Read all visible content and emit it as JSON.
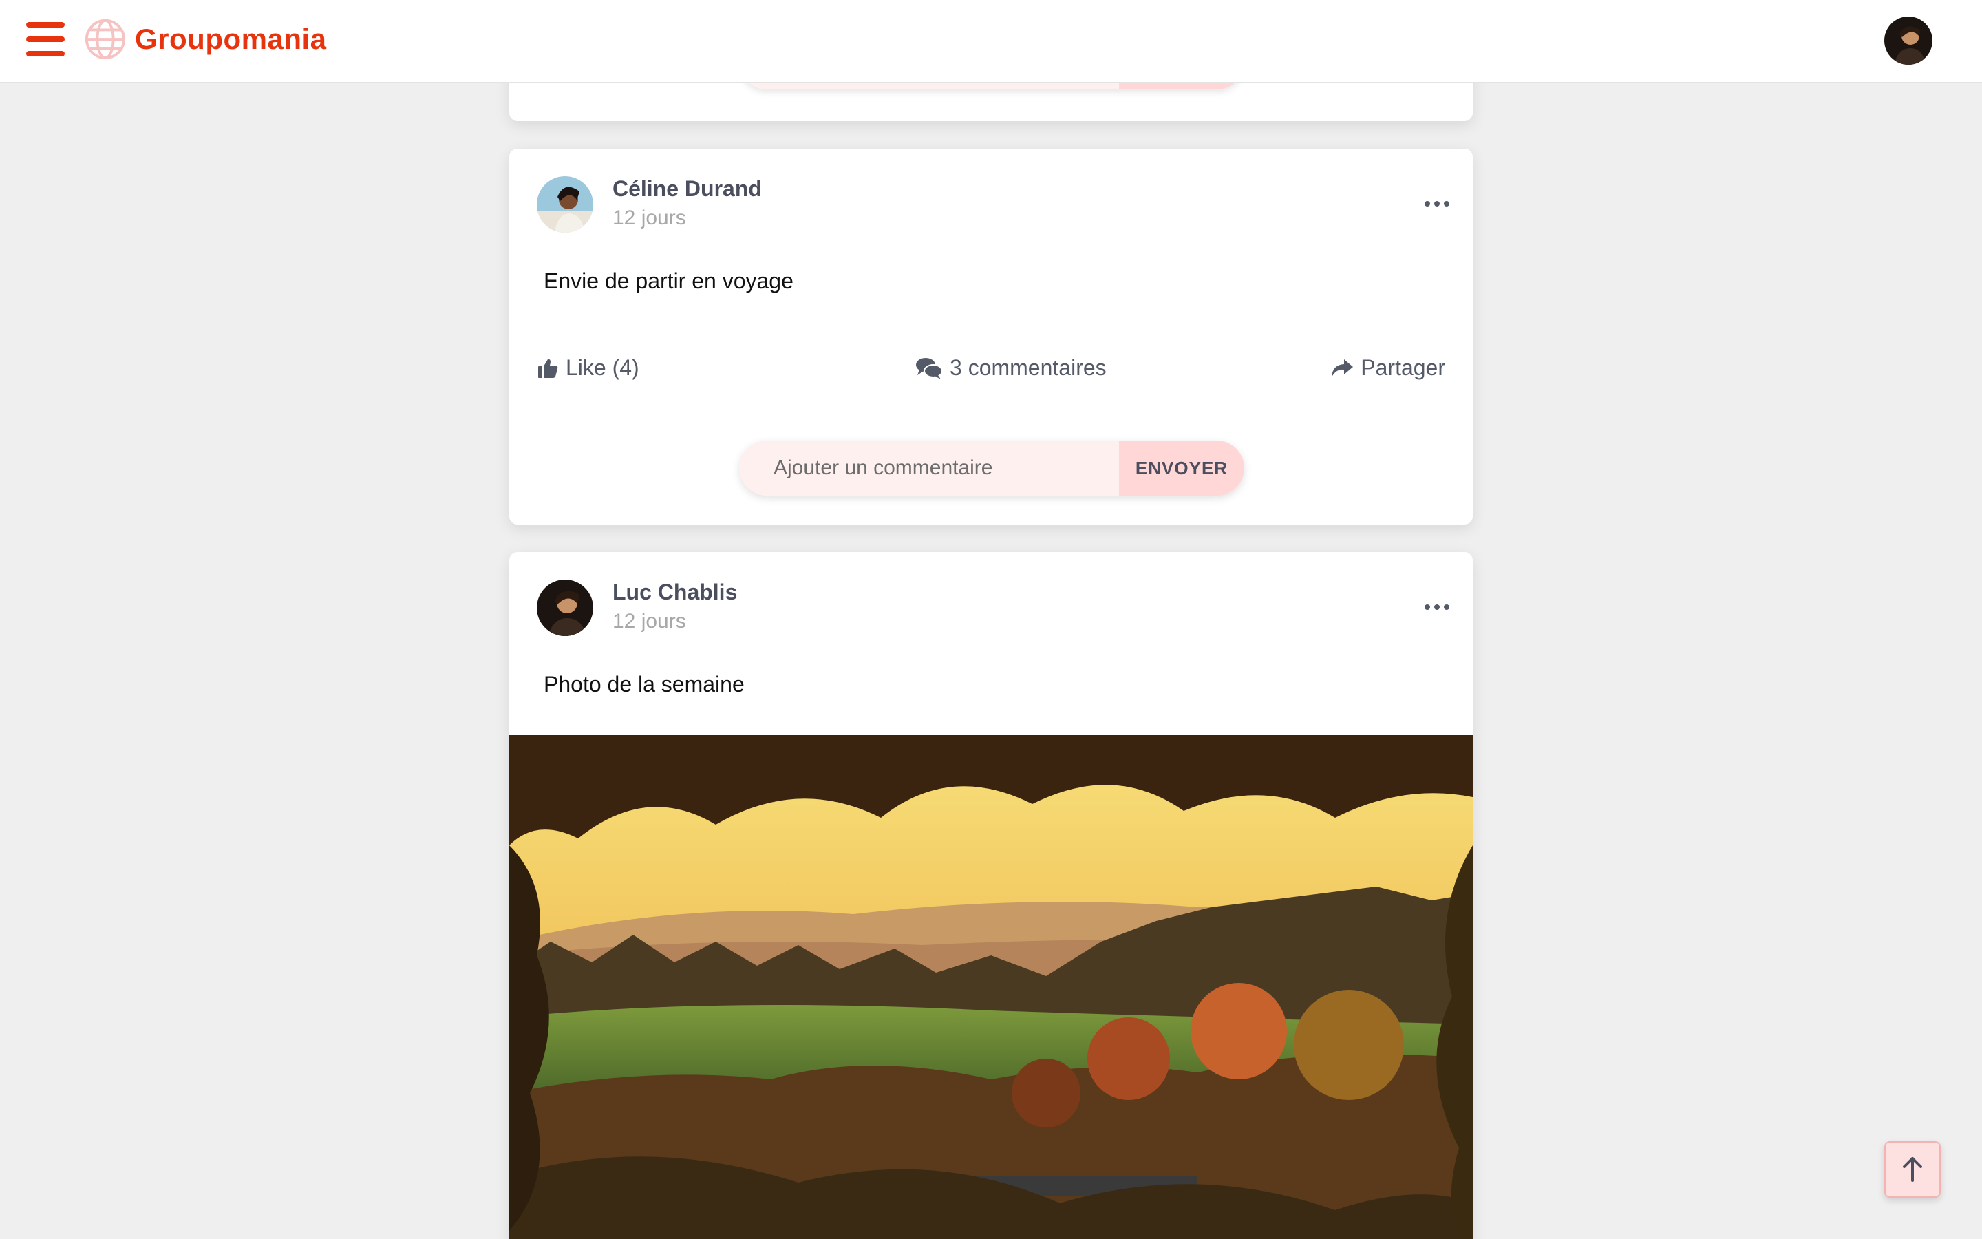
{
  "app": {
    "name": "Groupomania"
  },
  "header": {
    "menu_icon": "hamburger-icon",
    "logo_icon": "globe-icon",
    "avatar_icon": "user-avatar"
  },
  "posts": [
    {
      "author": "Céline Durand",
      "time": "12 jours",
      "text": "Envie de partir en voyage",
      "like_label": "Like (4)",
      "comments_label": "3 commentaires",
      "share_label": "Partager",
      "comment_placeholder": "Ajouter un commentaire",
      "send_label": "ENVOYER"
    },
    {
      "author": "Luc Chablis",
      "time": "12 jours",
      "text": "Photo de la semaine"
    }
  ],
  "colors": {
    "brand": "#e8340e",
    "background": "#efefef",
    "text_muted": "#a8a8a8",
    "action_text": "#555a69",
    "send_button": "#ffd7d7"
  },
  "icons": {
    "like": "thumbs-up-icon",
    "comments": "comments-icon",
    "share": "share-arrow-icon",
    "more": "more-dots-icon",
    "scroll_top": "arrow-up-icon"
  }
}
